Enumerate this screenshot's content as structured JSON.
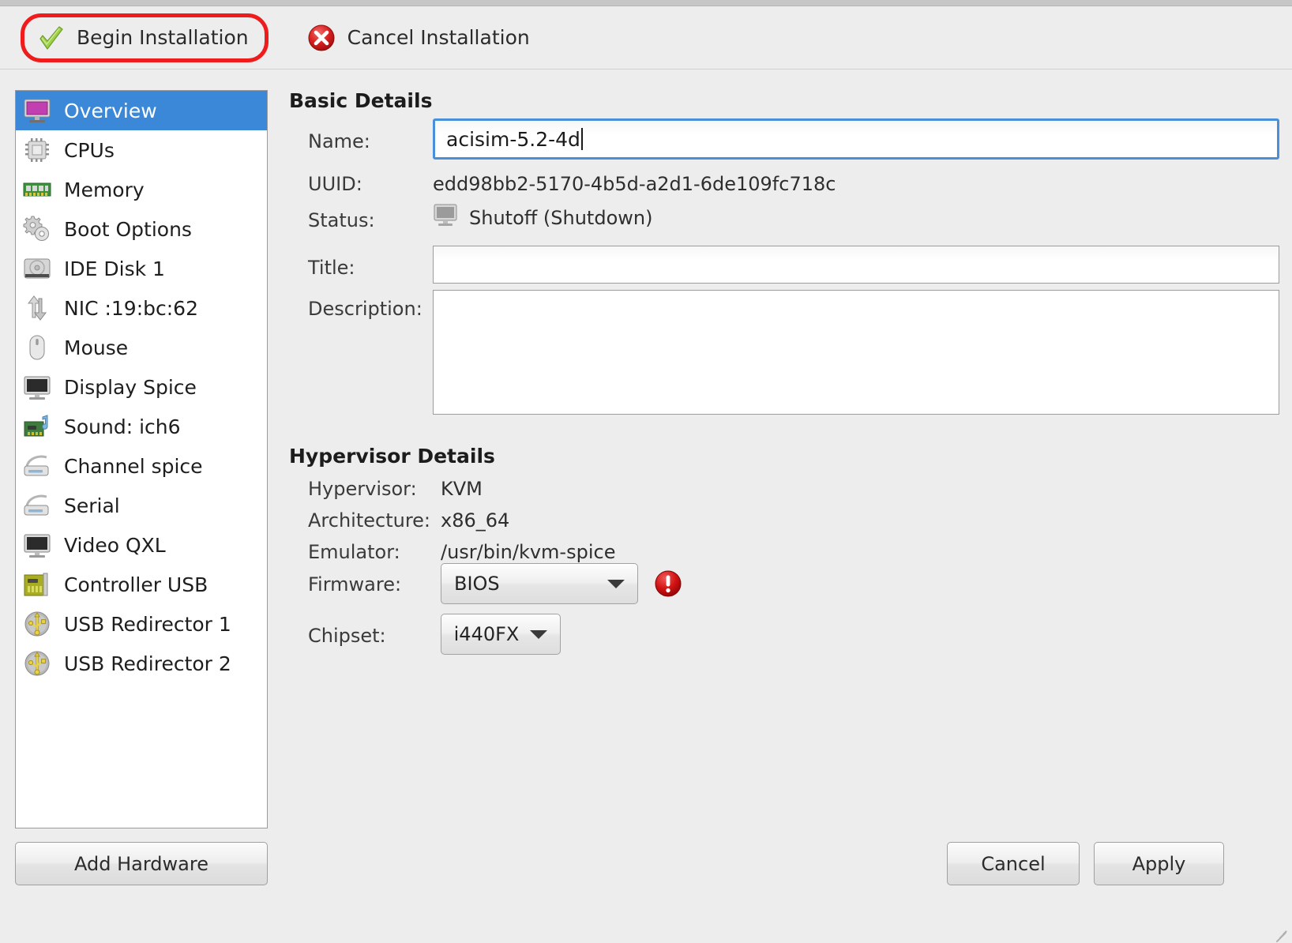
{
  "toolbar": {
    "begin_installation": "Begin Installation",
    "cancel_installation": "Cancel Installation",
    "highlight_color": "#ee1c1c"
  },
  "sidebar": {
    "items": [
      {
        "label": "Overview",
        "icon": "monitor-magenta-icon",
        "selected": true
      },
      {
        "label": "CPUs",
        "icon": "cpu-chip-icon",
        "selected": false
      },
      {
        "label": "Memory",
        "icon": "memory-dimm-icon",
        "selected": false
      },
      {
        "label": "Boot Options",
        "icon": "gears-icon",
        "selected": false
      },
      {
        "label": "IDE Disk 1",
        "icon": "harddisk-icon",
        "selected": false
      },
      {
        "label": "NIC :19:bc:62",
        "icon": "network-arrows-icon",
        "selected": false
      },
      {
        "label": "Mouse",
        "icon": "mouse-icon",
        "selected": false
      },
      {
        "label": "Display Spice",
        "icon": "monitor-dark-icon",
        "selected": false
      },
      {
        "label": "Sound: ich6",
        "icon": "soundcard-icon",
        "selected": false
      },
      {
        "label": "Channel spice",
        "icon": "serial-device-icon",
        "selected": false
      },
      {
        "label": "Serial",
        "icon": "serial-device-icon",
        "selected": false
      },
      {
        "label": "Video QXL",
        "icon": "monitor-dark-icon",
        "selected": false
      },
      {
        "label": "Controller USB",
        "icon": "controller-card-icon",
        "selected": false
      },
      {
        "label": "USB Redirector 1",
        "icon": "usb-icon",
        "selected": false
      },
      {
        "label": "USB Redirector 2",
        "icon": "usb-icon",
        "selected": false
      }
    ],
    "selected_color": "#3b88d8",
    "add_hardware": "Add Hardware"
  },
  "basic_details": {
    "heading": "Basic Details",
    "name_label": "Name:",
    "name_value": "acisim-5.2-4d",
    "uuid_label": "UUID:",
    "uuid_value": "edd98bb2-5170-4b5d-a2d1-6de109fc718c",
    "status_label": "Status:",
    "status_value": "Shutoff (Shutdown)",
    "status_icon": "monitor-grey-icon",
    "title_label": "Title:",
    "title_value": "",
    "description_label": "Description:",
    "description_value": ""
  },
  "hypervisor_details": {
    "heading": "Hypervisor Details",
    "hypervisor_label": "Hypervisor:",
    "hypervisor_value": "KVM",
    "architecture_label": "Architecture:",
    "architecture_value": "x86_64",
    "emulator_label": "Emulator:",
    "emulator_value": "/usr/bin/kvm-spice",
    "firmware_label": "Firmware:",
    "firmware_value": "BIOS",
    "firmware_warning_icon": "error-circle-icon",
    "chipset_label": "Chipset:",
    "chipset_value": "i440FX"
  },
  "footer": {
    "cancel": "Cancel",
    "apply": "Apply"
  }
}
